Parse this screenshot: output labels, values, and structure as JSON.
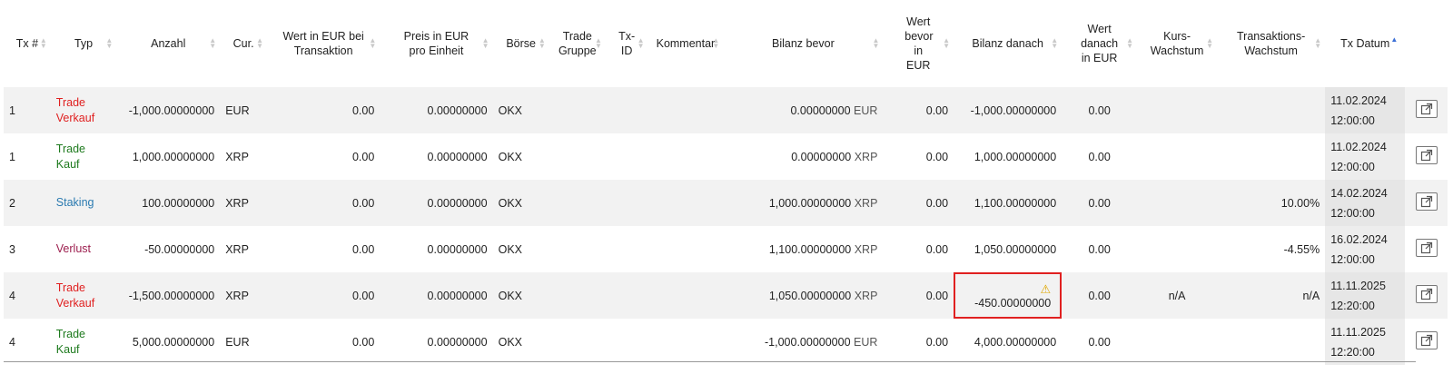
{
  "columns": [
    {
      "label": "Tx #"
    },
    {
      "label": "Typ"
    },
    {
      "label": "Anzahl"
    },
    {
      "label": "Cur."
    },
    {
      "label": "Wert in EUR bei Transaktion"
    },
    {
      "label": "Preis in EUR pro Einheit"
    },
    {
      "label": "Börse"
    },
    {
      "label": "Trade Gruppe"
    },
    {
      "label": "Tx-ID"
    },
    {
      "label": "Kommentar"
    },
    {
      "label": "Bilanz bevor"
    },
    {
      "label": "Wert bevor in EUR"
    },
    {
      "label": "Bilanz danach"
    },
    {
      "label": "Wert danach in EUR"
    },
    {
      "label": "Kurs-Wachstum"
    },
    {
      "label": "Transaktions-Wachstum"
    },
    {
      "label": "Tx Datum"
    }
  ],
  "sorted_column": "Tx Datum",
  "rows": [
    {
      "tx": "1",
      "type": "Trade Verkauf",
      "type_color": "#e02020",
      "amount": "-1,000.00000000",
      "cur": "EUR",
      "value_eur": "0.00",
      "price": "0.00000000",
      "exchange": "OKX",
      "bal_before_num": "0.00000000",
      "bal_before_unit": "EUR",
      "val_before": "0.00",
      "bal_after": "-1,000.00000000",
      "val_after": "0.00",
      "kurs": "",
      "tx_growth": "",
      "date": "11.02.2024",
      "time": "12:00:00"
    },
    {
      "tx": "1",
      "type": "Trade Kauf",
      "type_color": "#1e7a1e",
      "amount": "1,000.00000000",
      "cur": "XRP",
      "value_eur": "0.00",
      "price": "0.00000000",
      "exchange": "OKX",
      "bal_before_num": "0.00000000",
      "bal_before_unit": "XRP",
      "val_before": "0.00",
      "bal_after": "1,000.00000000",
      "val_after": "0.00",
      "kurs": "",
      "tx_growth": "",
      "date": "11.02.2024",
      "time": "12:00:00"
    },
    {
      "tx": "2",
      "type": "Staking",
      "type_color": "#2a7ab0",
      "amount": "100.00000000",
      "cur": "XRP",
      "value_eur": "0.00",
      "price": "0.00000000",
      "exchange": "OKX",
      "bal_before_num": "1,000.00000000",
      "bal_before_unit": "XRP",
      "val_before": "0.00",
      "bal_after": "1,100.00000000",
      "val_after": "0.00",
      "kurs": "",
      "tx_growth": "10.00%",
      "date": "14.02.2024",
      "time": "12:00:00"
    },
    {
      "tx": "3",
      "type": "Verlust",
      "type_color": "#9c1e4e",
      "amount": "-50.00000000",
      "cur": "XRP",
      "value_eur": "0.00",
      "price": "0.00000000",
      "exchange": "OKX",
      "bal_before_num": "1,100.00000000",
      "bal_before_unit": "XRP",
      "val_before": "0.00",
      "bal_after": "1,050.00000000",
      "val_after": "0.00",
      "kurs": "",
      "tx_growth": "-4.55%",
      "date": "16.02.2024",
      "time": "12:00:00"
    },
    {
      "tx": "4",
      "type": "Trade Verkauf",
      "type_color": "#e02020",
      "amount": "-1,500.00000000",
      "cur": "XRP",
      "value_eur": "0.00",
      "price": "0.00000000",
      "exchange": "OKX",
      "bal_before_num": "1,050.00000000",
      "bal_before_unit": "XRP",
      "val_before": "0.00",
      "bal_after": "-450.00000000",
      "bal_after_warning": true,
      "val_after": "0.00",
      "kurs": "n/A",
      "tx_growth": "n/A",
      "date": "11.11.2025",
      "time": "12:20:00"
    },
    {
      "tx": "4",
      "type": "Trade Kauf",
      "type_color": "#1e7a1e",
      "amount": "5,000.00000000",
      "cur": "EUR",
      "value_eur": "0.00",
      "price": "0.00000000",
      "exchange": "OKX",
      "bal_before_num": "-1,000.00000000",
      "bal_before_unit": "EUR",
      "val_before": "0.00",
      "bal_after": "4,000.00000000",
      "val_after": "0.00",
      "kurs": "",
      "tx_growth": "",
      "date": "11.11.2025",
      "time": "12:20:00"
    }
  ],
  "icons": {
    "sort": "sort-icon",
    "warning": "warning-icon",
    "open": "external-link-icon"
  },
  "colors": {
    "highlight_border": "#e02020",
    "warning": "#e0a800",
    "sort_active": "#3b6fd6"
  }
}
